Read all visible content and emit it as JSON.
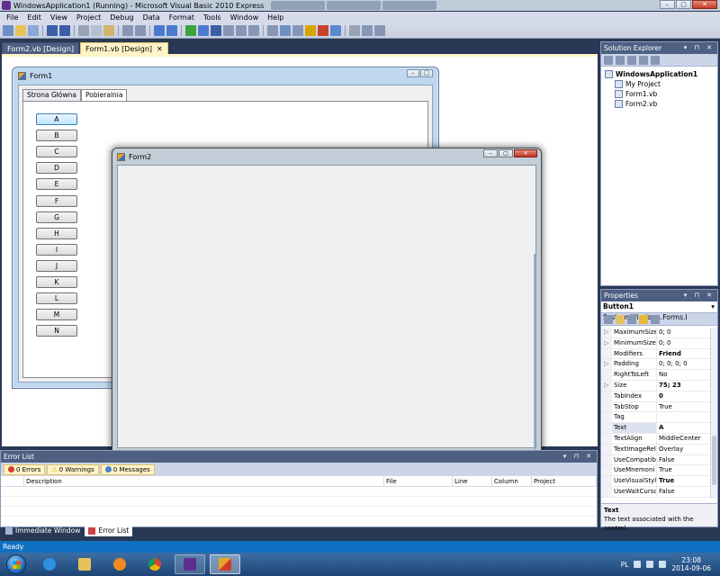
{
  "window": {
    "title": "WindowsApplication1 (Running) - Microsoft Visual Basic 2010 Express"
  },
  "menu": [
    "File",
    "Edit",
    "View",
    "Project",
    "Debug",
    "Data",
    "Format",
    "Tools",
    "Window",
    "Help"
  ],
  "doc_tabs": [
    {
      "label": "Form2.vb [Design]",
      "active": false
    },
    {
      "label": "Form1.vb [Design]",
      "active": true
    }
  ],
  "form1": {
    "title": "Form1",
    "tabs": [
      "Strona Główna",
      "Pobieralnia"
    ],
    "selected_tab": "Pobieralnia",
    "buttons": [
      "A",
      "B",
      "C",
      "D",
      "E",
      "F",
      "G",
      "H",
      "I",
      "J",
      "K",
      "L",
      "M",
      "N"
    ],
    "selected_button": "A"
  },
  "form2": {
    "title": "Form2"
  },
  "solution_explorer": {
    "title": "Solution Explorer",
    "items": [
      {
        "label": "WindowsApplication1",
        "bold": true,
        "level": 0
      },
      {
        "label": "My Project",
        "bold": false,
        "level": 1
      },
      {
        "label": "Form1.vb",
        "bold": false,
        "level": 1
      },
      {
        "label": "Form2.vb",
        "bold": false,
        "level": 1
      }
    ]
  },
  "properties": {
    "title": "Properties",
    "object_name": "Button1",
    "object_type": "System.Windows.Forms.I",
    "rows": [
      {
        "expand": "▷",
        "name": "MaximumSize",
        "value": "0; 0",
        "bold": false
      },
      {
        "expand": "▷",
        "name": "MinimumSize",
        "value": "0; 0",
        "bold": false
      },
      {
        "expand": "",
        "name": "Modifiers",
        "value": "Friend",
        "bold": true
      },
      {
        "expand": "▷",
        "name": "Padding",
        "value": "0; 0; 0; 0",
        "bold": false
      },
      {
        "expand": "",
        "name": "RightToLeft",
        "value": "No",
        "bold": false
      },
      {
        "expand": "▷",
        "name": "Size",
        "value": "75; 23",
        "bold": true
      },
      {
        "expand": "",
        "name": "TabIndex",
        "value": "0",
        "bold": true
      },
      {
        "expand": "",
        "name": "TabStop",
        "value": "True",
        "bold": false
      },
      {
        "expand": "",
        "name": "Tag",
        "value": "",
        "bold": false
      },
      {
        "expand": "",
        "name": "Text",
        "value": "A",
        "bold": true
      },
      {
        "expand": "",
        "name": "TextAlign",
        "value": "MiddleCenter",
        "bold": false
      },
      {
        "expand": "",
        "name": "TextImageRel",
        "value": "Overlay",
        "bold": false
      },
      {
        "expand": "",
        "name": "UseCompatib",
        "value": "False",
        "bold": false
      },
      {
        "expand": "",
        "name": "UseMnemoni",
        "value": "True",
        "bold": false
      },
      {
        "expand": "",
        "name": "UseVisualStyle",
        "value": "True",
        "bold": true
      },
      {
        "expand": "",
        "name": "UseWaitCursc",
        "value": "False",
        "bold": false
      }
    ],
    "selected_row": "Text",
    "desc_title": "Text",
    "desc_text": "The text associated with the control."
  },
  "error_list": {
    "title": "Error List",
    "filters": [
      "0 Errors",
      "0 Warnings",
      "0 Messages"
    ],
    "columns": [
      "Description",
      "File",
      "Line",
      "Column",
      "Project"
    ]
  },
  "bottom_tabs": [
    "Immediate Window",
    "Error List"
  ],
  "status": "Ready",
  "taskbar": {
    "lang": "PL",
    "time": "23:08",
    "date": "2014-09-06"
  }
}
